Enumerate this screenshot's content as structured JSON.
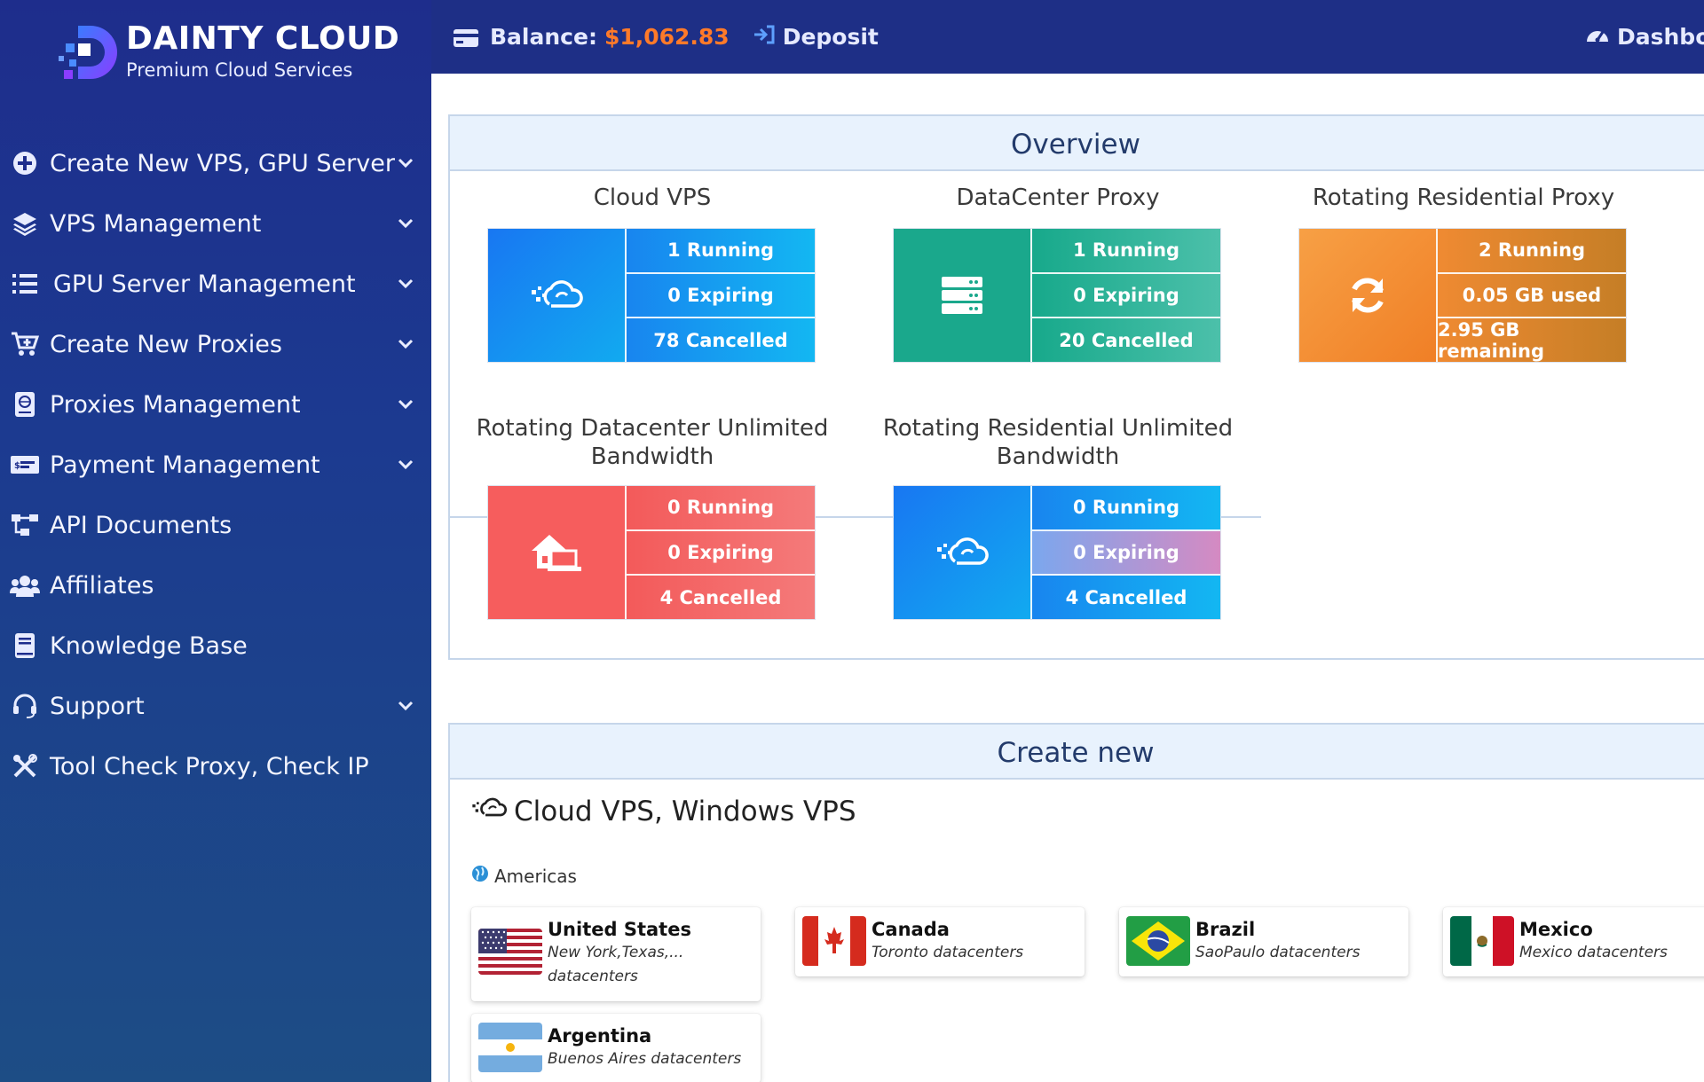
{
  "brand": {
    "name": "DAINTY CLOUD",
    "tagline": "Premium Cloud Services"
  },
  "sidebar": {
    "items": [
      {
        "label": "Create New VPS, GPU Server",
        "icon": "plus-circle-icon",
        "has_dropdown": true
      },
      {
        "label": "VPS Management",
        "icon": "layers-icon",
        "has_dropdown": true
      },
      {
        "label": "GPU Server Management",
        "icon": "list-icon",
        "has_dropdown": true
      },
      {
        "label": "Create New Proxies",
        "icon": "cart-plus-icon",
        "has_dropdown": true
      },
      {
        "label": "Proxies Management",
        "icon": "globe-book-icon",
        "has_dropdown": true
      },
      {
        "label": "Payment Management",
        "icon": "money-card-icon",
        "has_dropdown": true
      },
      {
        "label": "API Documents",
        "icon": "sitemap-icon",
        "has_dropdown": false
      },
      {
        "label": "Affiliates",
        "icon": "users-icon",
        "has_dropdown": false
      },
      {
        "label": "Knowledge Base",
        "icon": "book-icon",
        "has_dropdown": false
      },
      {
        "label": "Support",
        "icon": "headset-icon",
        "has_dropdown": true
      },
      {
        "label": "Tool Check Proxy, Check IP",
        "icon": "tools-icon",
        "has_dropdown": false
      }
    ]
  },
  "topbar": {
    "balance_label": "Balance:",
    "balance_amount": "$1,062.83",
    "deposit_label": "Deposit",
    "dashboard_label": "Dashboard"
  },
  "overview": {
    "title": "Overview",
    "services": [
      {
        "title": "Cloud VPS",
        "stats": [
          "1 Running",
          "0 Expiring",
          "78 Cancelled"
        ],
        "icon": "cloud-icon"
      },
      {
        "title": "DataCenter Proxy",
        "stats": [
          "1 Running",
          "0 Expiring",
          "20 Cancelled"
        ],
        "icon": "server-icon"
      },
      {
        "title": "Rotating Residential Proxy",
        "stats": [
          "2 Running",
          "0.05 GB used",
          "2.95 GB remaining"
        ],
        "icon": "sync-icon"
      },
      {
        "title": "Rotating Datacenter Unlimited Bandwidth",
        "stats": [
          "0 Running",
          "0 Expiring",
          "4 Cancelled"
        ],
        "icon": "house-laptop-icon"
      },
      {
        "title": "Rotating Residential Unlimited Bandwidth",
        "stats": [
          "0 Running",
          "0 Expiring",
          "4 Cancelled"
        ],
        "icon": "cloud-icon"
      }
    ]
  },
  "create_new": {
    "title": "Create new",
    "section_title": "Cloud VPS, Windows VPS",
    "region": "Americas",
    "locations": [
      {
        "name": "United States",
        "desc": "New York,Texas,...",
        "desc2": "datacenters",
        "flag": "us-flag-icon"
      },
      {
        "name": "Canada",
        "desc": "Toronto datacenters",
        "flag": "canada-flag-icon"
      },
      {
        "name": "Brazil",
        "desc": "SaoPaulo datacenters",
        "flag": "brazil-flag-icon"
      },
      {
        "name": "Mexico",
        "desc": "Mexico datacenters",
        "flag": "mexico-flag-icon"
      },
      {
        "name": "Argentina",
        "desc": "Buenos Aires datacenters",
        "flag": "argentina-flag-icon"
      }
    ]
  },
  "colors": {
    "sidebar": "#1e2d8c",
    "topbar": "#1e2f86",
    "balance": "#ff7a29",
    "accent_blue": "#1877f2",
    "teal": "#1aa88c",
    "orange": "#f07f26",
    "red": "#f65d5d"
  }
}
